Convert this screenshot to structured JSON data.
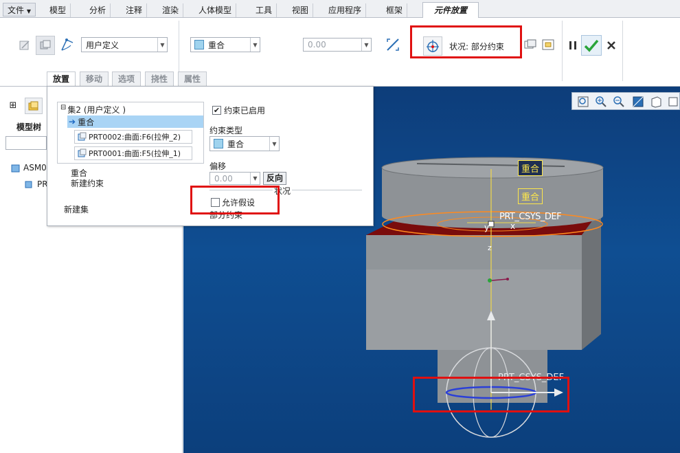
{
  "menubar": {
    "file": "文件",
    "tabs": [
      "模型",
      "分析",
      "注释",
      "渲染",
      "人体模型",
      "工具",
      "视图",
      "应用程序",
      "框架"
    ],
    "active_tab": "元件放置"
  },
  "ribbon": {
    "constraint_set_dropdown": "用户定义",
    "constraint_type_dropdown": "重合",
    "offset_value": "0.00",
    "status_label": "状况:  部分约束"
  },
  "panel_tabs": [
    "放置",
    "移动",
    "选项",
    "挠性",
    "属性"
  ],
  "panel": {
    "set_header": "集2 (用户定义 )",
    "constraint_item": "重合",
    "refs": [
      "PRT0002:曲面:F6(拉伸_2)",
      "PRT0001:曲面:F5(拉伸_1)"
    ],
    "constraint_label": "重合",
    "new_constraint": "新建约束",
    "new_set": "新建集",
    "enabled_label": "约束已启用",
    "type_label": "约束类型",
    "type_value": "重合",
    "offset_label": "偏移",
    "offset_value": "0.00",
    "reverse_button": "反向",
    "status_title": "状况",
    "allow_assumption": "允许假设",
    "status_value": "部分约束"
  },
  "left": {
    "model_tree": "模型树",
    "tree_items": [
      "ASM0",
      "PR"
    ]
  },
  "viewport": {
    "tag1": "重合",
    "tag2": "重合",
    "csys_top": "PRT_CSYS_DEF",
    "csys_bottom": "PRT_CSYS_DEF",
    "axis_y": "y",
    "axis_x": "x",
    "axis_z": "z"
  },
  "colors": {
    "accent": "#e01010",
    "viewport_bg": "#0f4e92",
    "label_yellow": "#ffe84a",
    "check_green": "#2aa43a"
  }
}
